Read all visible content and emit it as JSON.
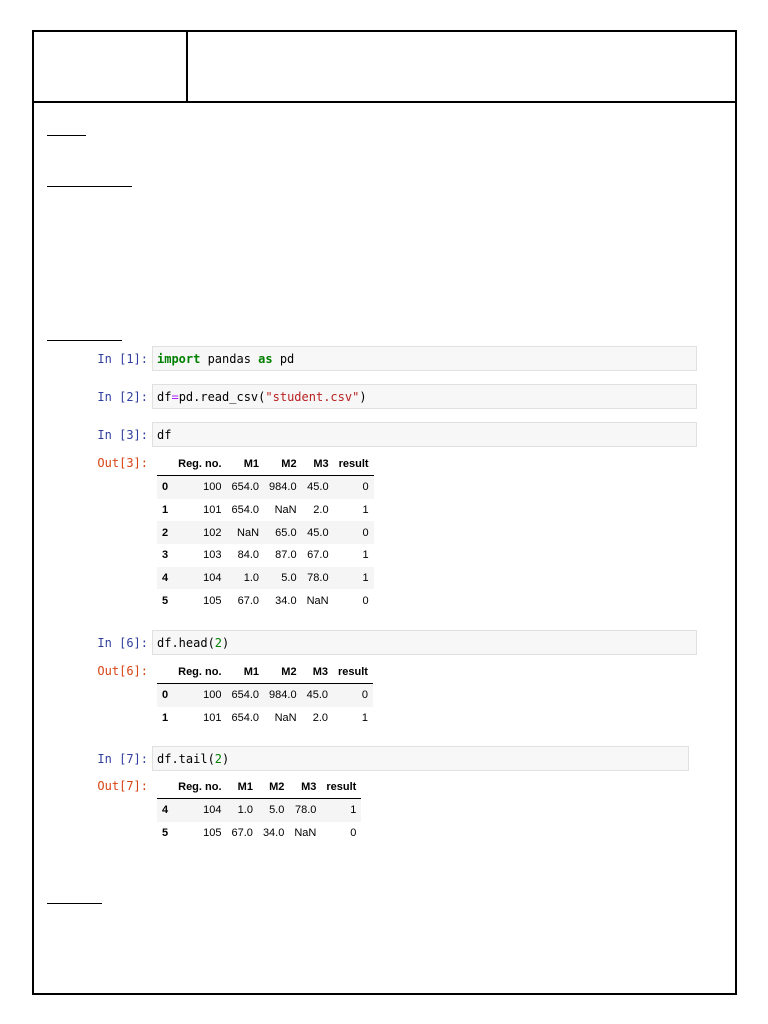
{
  "cells": [
    {
      "prompt": "In [1]:",
      "code": [
        {
          "t": "import",
          "c": "kw"
        },
        {
          "t": " pandas ",
          "c": ""
        },
        {
          "t": "as",
          "c": "kw"
        },
        {
          "t": " pd",
          "c": ""
        }
      ]
    },
    {
      "prompt": "In [2]:",
      "code": [
        {
          "t": "df",
          "c": ""
        },
        {
          "t": "=",
          "c": "op"
        },
        {
          "t": "pd.read_csv(",
          "c": ""
        },
        {
          "t": "\"student.csv\"",
          "c": "str"
        },
        {
          "t": ")",
          "c": ""
        }
      ]
    },
    {
      "prompt": "In [3]:",
      "code": [
        {
          "t": "df",
          "c": ""
        }
      ],
      "out": "Out[3]:",
      "rows": [
        [
          "0",
          "100",
          "654.0",
          "984.0",
          "45.0",
          "0"
        ],
        [
          "1",
          "101",
          "654.0",
          "NaN",
          "2.0",
          "1"
        ],
        [
          "2",
          "102",
          "NaN",
          "65.0",
          "45.0",
          "0"
        ],
        [
          "3",
          "103",
          "84.0",
          "87.0",
          "67.0",
          "1"
        ],
        [
          "4",
          "104",
          "1.0",
          "5.0",
          "78.0",
          "1"
        ],
        [
          "5",
          "105",
          "67.0",
          "34.0",
          "NaN",
          "0"
        ]
      ]
    },
    {
      "prompt": "In [6]:",
      "code": [
        {
          "t": "df.head(",
          "c": ""
        },
        {
          "t": "2",
          "c": "num"
        },
        {
          "t": ")",
          "c": ""
        }
      ],
      "out": "Out[6]:",
      "rows": [
        [
          "0",
          "100",
          "654.0",
          "984.0",
          "45.0",
          "0"
        ],
        [
          "1",
          "101",
          "654.0",
          "NaN",
          "2.0",
          "1"
        ]
      ]
    },
    {
      "prompt": "In [7]:",
      "code": [
        {
          "t": "df.tail(",
          "c": ""
        },
        {
          "t": "2",
          "c": "num"
        },
        {
          "t": ")",
          "c": ""
        }
      ],
      "out": "Out[7]:",
      "rows": [
        [
          "4",
          "104",
          "1.0",
          "5.0",
          "78.0",
          "1"
        ],
        [
          "5",
          "105",
          "67.0",
          "34.0",
          "NaN",
          "0"
        ]
      ]
    }
  ],
  "columns": [
    "",
    "Reg. no.",
    "M1",
    "M2",
    "M3",
    "result"
  ]
}
